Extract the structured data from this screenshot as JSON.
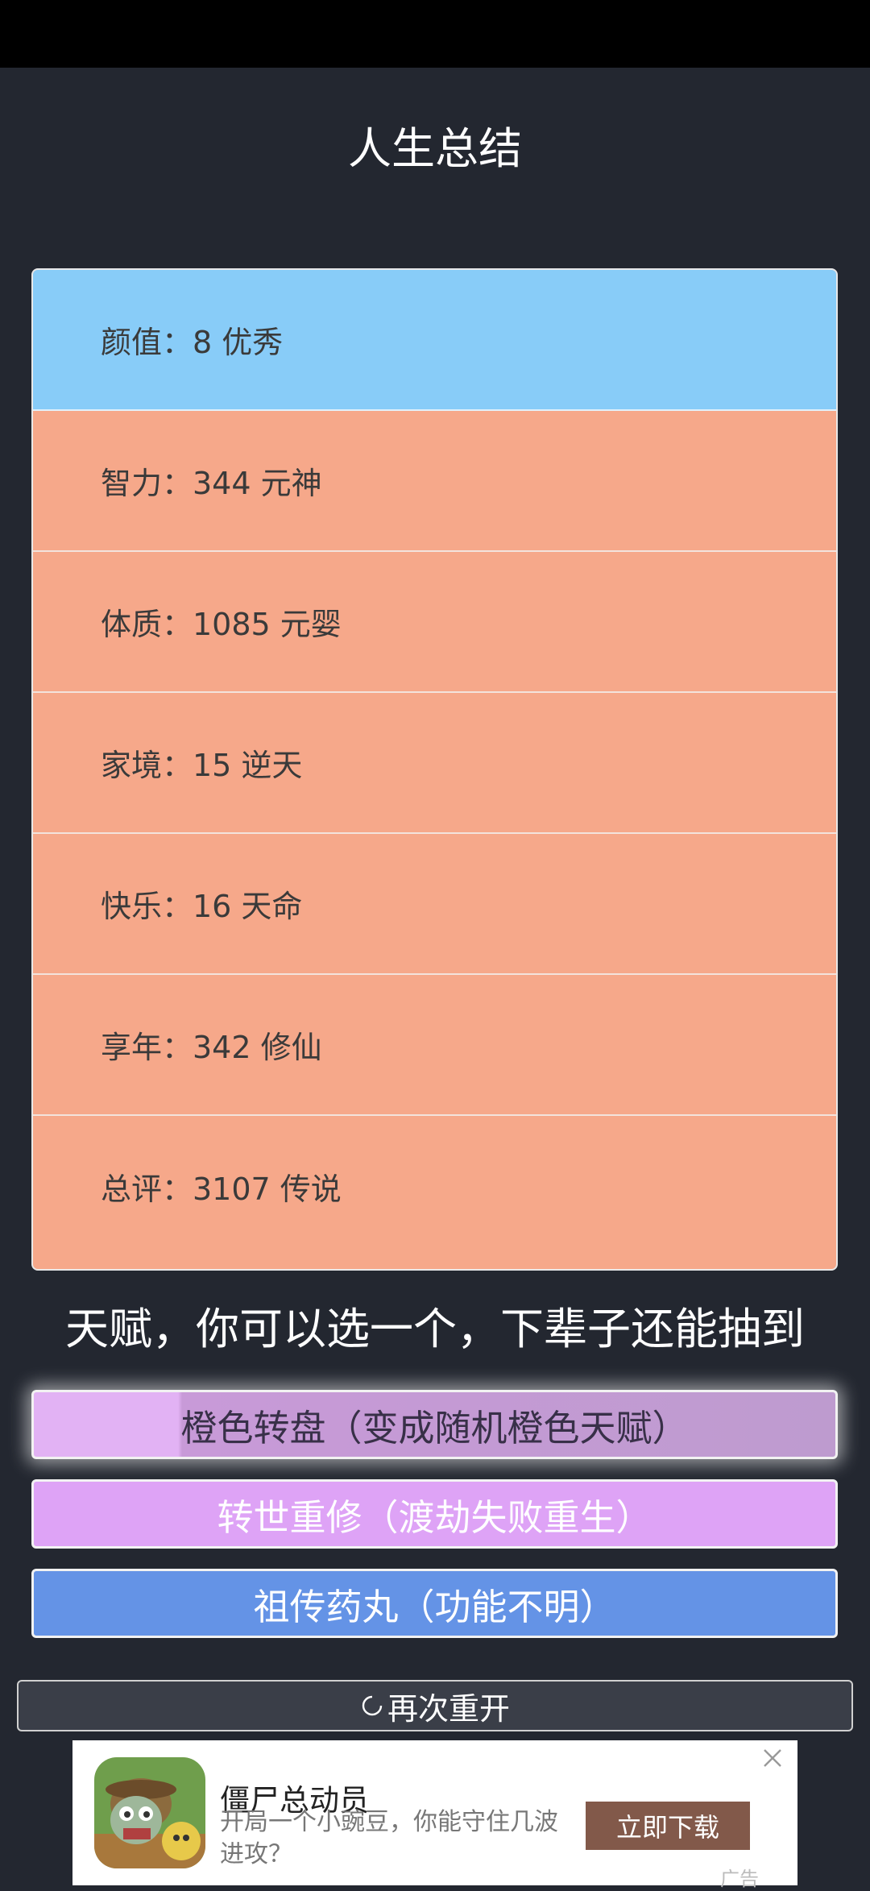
{
  "title": "人生总结",
  "summary": {
    "rows": [
      {
        "label": "颜值：8 优秀"
      },
      {
        "label": "智力：344 元神"
      },
      {
        "label": "体质：1085 元婴"
      },
      {
        "label": "家境：15 逆天"
      },
      {
        "label": "快乐：16 天命"
      },
      {
        "label": "享年：342 修仙"
      },
      {
        "label": "总评：3107 传说"
      }
    ]
  },
  "talents": {
    "heading": "天赋，你可以选一个，下辈子还能抽到",
    "options": [
      {
        "label": "橙色转盘（变成随机橙色天赋）"
      },
      {
        "label": "转世重修（渡劫失败重生）"
      },
      {
        "label": "祖传药丸（功能不明）"
      }
    ]
  },
  "restart": {
    "label": "再次重开",
    "icon": "refresh-icon"
  },
  "ad": {
    "app_name": "僵尸总动员",
    "description": "开局一个小豌豆，你能守住几波进攻？",
    "download_label": "立即下载",
    "ad_label": "广告",
    "icon": "zombie-app-icon"
  },
  "colors": {
    "background": "#232730",
    "row_orange": "#f6a88a",
    "row_blue": "#88ccf8",
    "talent_purple": "#dea3f6",
    "talent_blue": "#6493e6",
    "download_brown": "#82594a"
  }
}
